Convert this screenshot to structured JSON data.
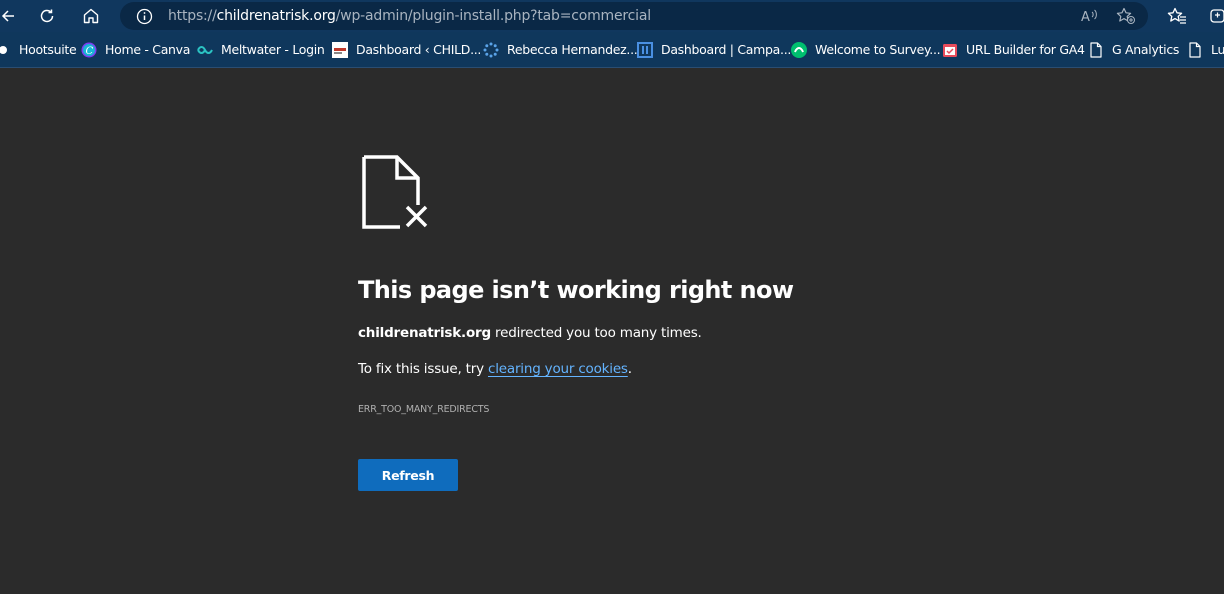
{
  "toolbar": {
    "address": {
      "scheme": "https://",
      "domain": "childrenatrisk.org",
      "path": "/wp-admin/plugin-install.php?tab=commercial"
    },
    "icons": [
      "back-icon",
      "refresh-icon",
      "home-icon",
      "site-info-icon",
      "read-aloud-icon",
      "add-favorite-icon",
      "favorites-icon",
      "collections-icon"
    ]
  },
  "bookmarks": [
    {
      "label": "Hootsuite",
      "icon": "hootsuite-icon"
    },
    {
      "label": "Home - Canva",
      "icon": "canva-icon"
    },
    {
      "label": "Meltwater - Login",
      "icon": "meltwater-icon"
    },
    {
      "label": "Dashboard ‹ CHILD...",
      "icon": "wordpress-site-icon"
    },
    {
      "label": "Rebecca Hernandez...",
      "icon": "spinner-icon"
    },
    {
      "label": "Dashboard | Campa...",
      "icon": "campaign-icon"
    },
    {
      "label": "Welcome to Survey...",
      "icon": "surveymonkey-icon"
    },
    {
      "label": "URL Builder for GA4",
      "icon": "calendar-check-icon"
    },
    {
      "label": "G Analytics",
      "icon": "page-icon"
    },
    {
      "label": "Lu",
      "icon": "page-icon"
    }
  ],
  "error": {
    "title": "This page isn’t working right now",
    "domain": "childrenatrisk.org",
    "message": " redirected you too many times.",
    "fix_prefix": "To fix this issue, try ",
    "fix_link": "clearing your cookies",
    "fix_suffix": ".",
    "code": "ERR_TOO_MANY_REDIRECTS",
    "button_label": "Refresh"
  },
  "colors": {
    "page_bg": "#2b2b2b",
    "toolbar_bg": "#10375e",
    "link": "#64b4ff",
    "button": "#0f6cbd"
  }
}
